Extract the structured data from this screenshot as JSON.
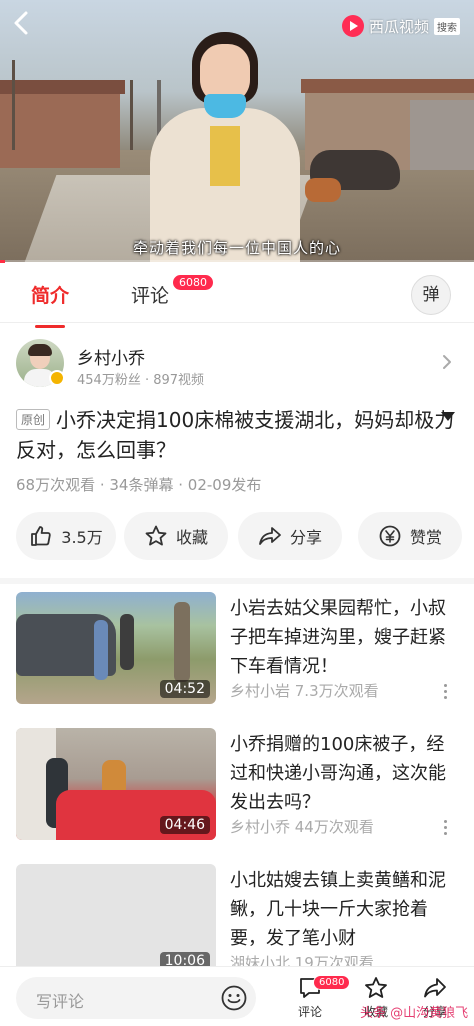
{
  "player": {
    "brand_name": "西瓜视频",
    "brand_tag": "搜索",
    "subtitle": "牵动着我们每一位中国人的心",
    "progress": 0.01
  },
  "tabs": {
    "intro": "简介",
    "comments": "评论",
    "comments_badge": "6080",
    "danmaku": "弹"
  },
  "author": {
    "name": "乡村小乔",
    "stats": "454万粉丝 · 897视频"
  },
  "video": {
    "original_tag": "原创",
    "title": "小乔决定捐100床棉被支援湖北，妈妈却极力反对，怎么回事？",
    "meta": "68万次观看 · 34条弹幕 · 02-09发布"
  },
  "actions": {
    "like": "3.5万",
    "favorite": "收藏",
    "share": "分享",
    "reward": "赞赏"
  },
  "feed": [
    {
      "title": "小岩去姑父果园帮忙，小叔子把车掉进沟里，嫂子赶紧下车看情况！",
      "meta": "乡村小岩  7.3万次观看",
      "duration": "04:52"
    },
    {
      "title": "小乔捐赠的100床被子，经过和快递小哥沟通，这次能发出去吗？",
      "meta": "乡村小乔  44万次观看",
      "duration": "04:46"
    },
    {
      "title": "小北姑嫂去镇上卖黄鳝和泥鳅，几十块一斤大家抢着要，发了笔小财",
      "meta": "湖妹小北  19万次观看",
      "duration": "10:06"
    }
  ],
  "bottom": {
    "comment_placeholder": "写评论",
    "comments_label": "评论",
    "comments_badge": "6080",
    "favorite_label": "收藏",
    "share_label": "分享",
    "watermark": "头条 @山沟黄狼飞"
  }
}
